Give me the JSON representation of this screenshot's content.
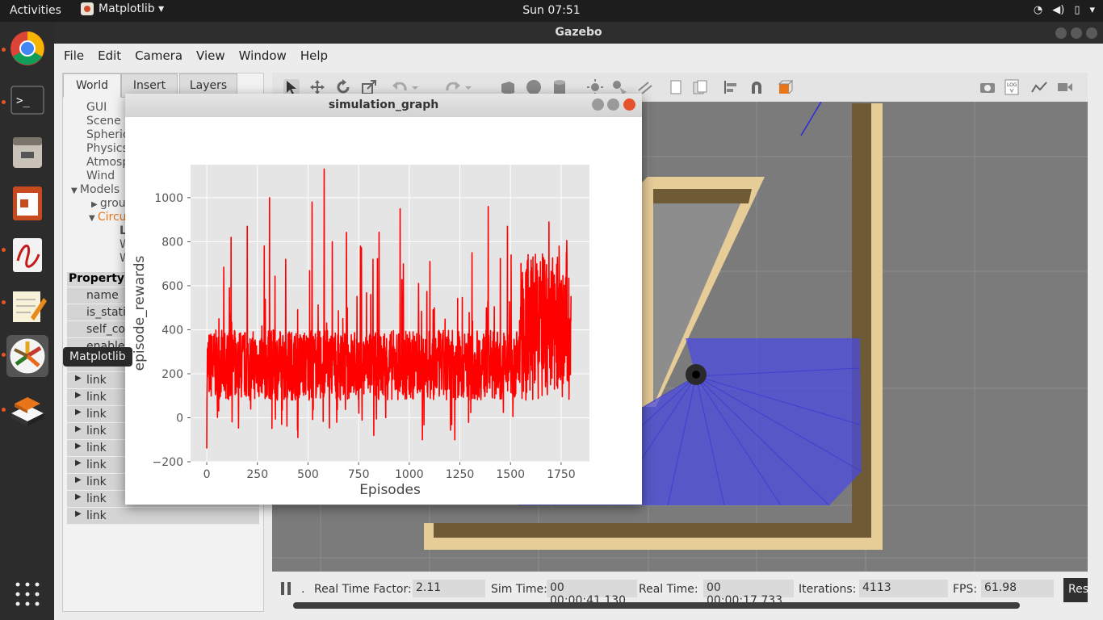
{
  "topbar": {
    "activities": "Activities",
    "app_name": "Matplotlib ▾",
    "clock": "Sun 07:51",
    "tray_icons": [
      "wifi-icon",
      "volume-icon",
      "battery-icon",
      "menu-arrow-icon"
    ]
  },
  "dock": {
    "items": [
      "chrome",
      "terminal",
      "files",
      "impress",
      "evince",
      "text-editor",
      "matplotlib",
      "gazebo"
    ],
    "tooltip": "Matplotlib",
    "accent": "#e95420"
  },
  "gazebo": {
    "title": "Gazebo",
    "menu": [
      "File",
      "Edit",
      "Camera",
      "View",
      "Window",
      "Help"
    ],
    "tabs": [
      "World",
      "Insert",
      "Layers"
    ],
    "tree": [
      "GUI",
      "Scene",
      "Spheric",
      "Physics",
      "Atmosp",
      "Wind",
      "Models",
      "grou",
      "Circu",
      "L",
      "W",
      "W"
    ],
    "property_header": "Property",
    "properties": [
      "name",
      "is_stati",
      "self_co",
      "enable_"
    ],
    "links": [
      "link",
      "link",
      "link",
      "link",
      "link",
      "link",
      "link",
      "link",
      "link"
    ],
    "status": {
      "rtf_label": "Real Time Factor:",
      "rtf": "2.11",
      "sim_label": "Sim Time:",
      "sim": "00 00:00:41.130",
      "real_label": "Real Time:",
      "real": "00 00:00:17.733",
      "iter_label": "Iterations:",
      "iter": "4113",
      "fps_label": "FPS:",
      "fps": "61.98",
      "reset": "Res"
    }
  },
  "plot_window": {
    "title": "simulation_graph"
  },
  "chart_data": {
    "type": "line",
    "title": "",
    "xlabel": "Episodes",
    "ylabel": "episode_rewards",
    "xlim": [
      -80,
      1890
    ],
    "ylim": [
      -200,
      1150
    ],
    "xticks": [
      0,
      250,
      500,
      750,
      1000,
      1250,
      1500,
      1750
    ],
    "yticks": [
      -200,
      0,
      200,
      400,
      600,
      800,
      1000
    ],
    "grid": true,
    "series": [
      {
        "color": "#ff0000",
        "n_points": 1800,
        "baseline_min": 80,
        "baseline_max": 400,
        "min": -140,
        "max": 1130,
        "peaks": [
          [
            0,
            -140
          ],
          [
            60,
            450
          ],
          [
            120,
            820
          ],
          [
            200,
            870
          ],
          [
            310,
            1000
          ],
          [
            390,
            720
          ],
          [
            450,
            -90
          ],
          [
            520,
            980
          ],
          [
            580,
            1130
          ],
          [
            620,
            800
          ],
          [
            810,
            560
          ],
          [
            825,
            -80
          ],
          [
            955,
            950
          ],
          [
            1065,
            -100
          ],
          [
            1225,
            -100
          ],
          [
            1390,
            960
          ],
          [
            1485,
            870
          ],
          [
            1560,
            660
          ],
          [
            1690,
            890
          ],
          [
            1740,
            780
          ],
          [
            1795,
            450
          ]
        ]
      }
    ]
  }
}
